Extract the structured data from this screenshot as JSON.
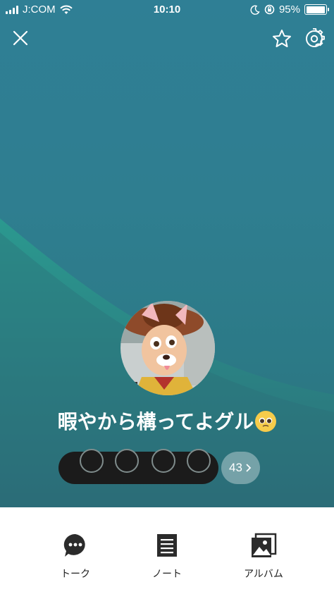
{
  "status_bar": {
    "carrier": "J:COM",
    "time": "10:10",
    "battery": "95%",
    "battery_level": 0.95
  },
  "header": {
    "close_icon": "close-icon",
    "favorite_icon": "star-icon",
    "settings_icon": "gear-icon"
  },
  "group": {
    "name": "暇やから構ってよグル",
    "emoji": "pleading-face-emoji",
    "member_count": "43"
  },
  "tabs": [
    {
      "label": "トーク",
      "icon": "chat-bubble-icon"
    },
    {
      "label": "ノート",
      "icon": "note-icon"
    },
    {
      "label": "アルバム",
      "icon": "album-icon"
    }
  ],
  "colors": {
    "background_teal": "#2f7f95",
    "wave_teal": "#2a9a8e",
    "tab_icon": "#2b2b2b"
  }
}
